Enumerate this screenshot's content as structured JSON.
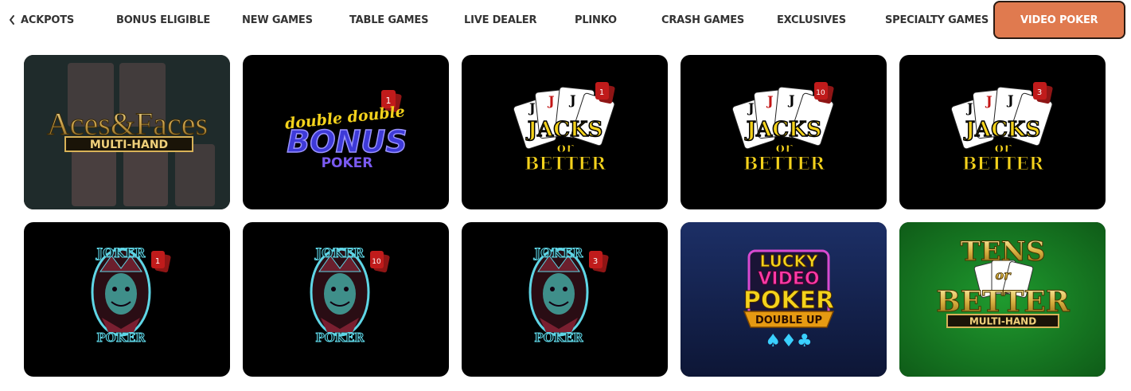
{
  "nav": {
    "back_icon": "chevron-left-icon",
    "items": [
      {
        "label": "ACKPOTS",
        "active": false
      },
      {
        "label": "BONUS ELIGIBLE",
        "active": false
      },
      {
        "label": "NEW GAMES",
        "active": false
      },
      {
        "label": "TABLE GAMES",
        "active": false
      },
      {
        "label": "LIVE DEALER",
        "active": false
      },
      {
        "label": "PLINKO",
        "active": false
      },
      {
        "label": "CRASH GAMES",
        "active": false
      },
      {
        "label": "EXCLUSIVES",
        "active": false
      },
      {
        "label": "SPECIALTY GAMES",
        "active": false
      },
      {
        "label": "VIDEO POKER",
        "active": true
      }
    ],
    "accent": "#e07a4f"
  },
  "games": [
    {
      "logo": [
        "Aces",
        "&",
        "Faces"
      ],
      "subtitle": "MULTI-HAND",
      "badge": null
    },
    {
      "logo": [
        "double double",
        "BONUS",
        "POKER"
      ],
      "badge": "1"
    },
    {
      "logo": [
        "JACKS",
        "or",
        "BETTER"
      ],
      "badge": "1"
    },
    {
      "logo": [
        "JACKS",
        "or",
        "BETTER"
      ],
      "badge": "10"
    },
    {
      "logo": [
        "JACKS",
        "or",
        "BETTER"
      ],
      "badge": "3"
    },
    {
      "logo": [
        "JOKER",
        "POKER"
      ],
      "badge": "1"
    },
    {
      "logo": [
        "JOKER",
        "POKER"
      ],
      "badge": "10"
    },
    {
      "logo": [
        "JOKER",
        "POKER"
      ],
      "badge": "3"
    },
    {
      "logo": [
        "LUCKY",
        "VIDEO",
        "POKER"
      ],
      "subtitle": "DOUBLE UP",
      "badge": null
    },
    {
      "logo": [
        "TENS",
        "or",
        "BETTER"
      ],
      "subtitle": "MULTI-HAND",
      "badge": null
    }
  ]
}
